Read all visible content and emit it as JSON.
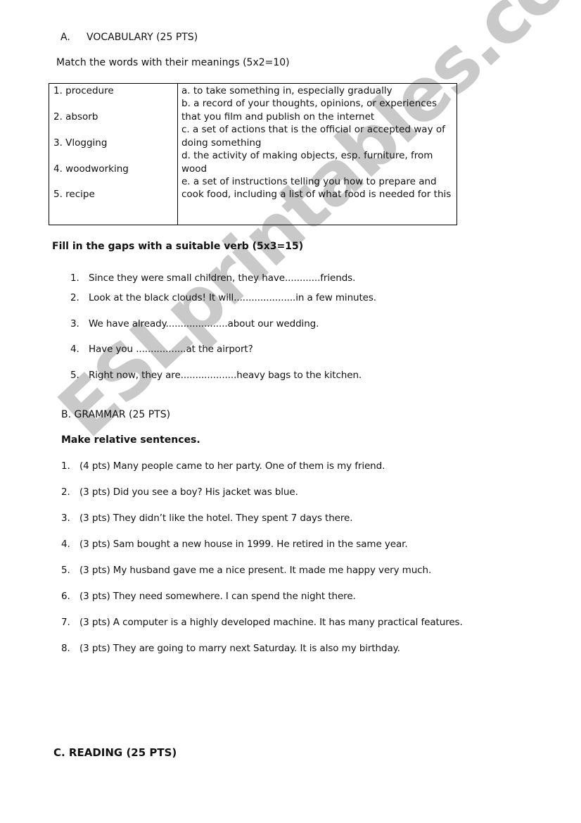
{
  "watermark": "ESLprintables.com",
  "section_a": {
    "letter": "A.",
    "title": "VOCABULARY (25 PTS)",
    "match_instruction": "Match the words with their meanings (5x2=10)",
    "words": [
      "1.  procedure",
      "2.  absorb",
      "3. Vlogging",
      "4. woodworking",
      "5. recipe"
    ],
    "meaning_lines": [
      "a. to take something in, especially gradually",
      "b. a record of your thoughts, opinions, or experiences",
      "that you film and publish on the internet",
      "c. a set of actions that is the official or accepted way of",
      "doing something",
      "d. the activity of making objects, esp. furniture, from",
      "wood",
      "e. a set of instructions telling you how to prepare and",
      "cook food, including a list of what food is needed for this"
    ],
    "fill_instruction": "Fill in the gaps with a suitable verb (5x3=15)",
    "fill_items": [
      {
        "num": "1.",
        "text": "Since they were small children, they have............friends."
      },
      {
        "num": "2.",
        "text": "Look at the black clouds! It will.....................in a few minutes."
      },
      {
        "num": "3.",
        "text": "We have already.....................about our wedding."
      },
      {
        "num": "4.",
        "text": "Have you .................at the airport?"
      },
      {
        "num": "5.",
        "text": "Right now, they are...................heavy bags to the kitchen."
      }
    ]
  },
  "section_b": {
    "title": "B.  GRAMMAR (25 PTS)",
    "instruction": "Make relative sentences.",
    "items": [
      {
        "num": "1.",
        "text": "(4 pts) Many people came to her party. One of them is my friend."
      },
      {
        "num": "2.",
        "text": "(3 pts) Did you see a boy? His jacket was blue."
      },
      {
        "num": "3.",
        "text": "(3 pts) They didn’t like the hotel. They spent 7 days there."
      },
      {
        "num": "4.",
        "text": "(3 pts) Sam bought a new house in 1999. He retired in the same year."
      },
      {
        "num": "5.",
        "text": "(3 pts) My husband gave me a nice present. It made me happy very much."
      },
      {
        "num": "6.",
        "text": "(3 pts) They need somewhere. I can spend the night there."
      },
      {
        "num": "7.",
        "text": "(3 pts) A computer is a highly developed machine. It has many practical features."
      },
      {
        "num": "8.",
        "text": "(3 pts) They are going to marry next Saturday. It is also my birthday."
      }
    ]
  },
  "section_c": {
    "title": "C.  READING (25 PTS)"
  }
}
